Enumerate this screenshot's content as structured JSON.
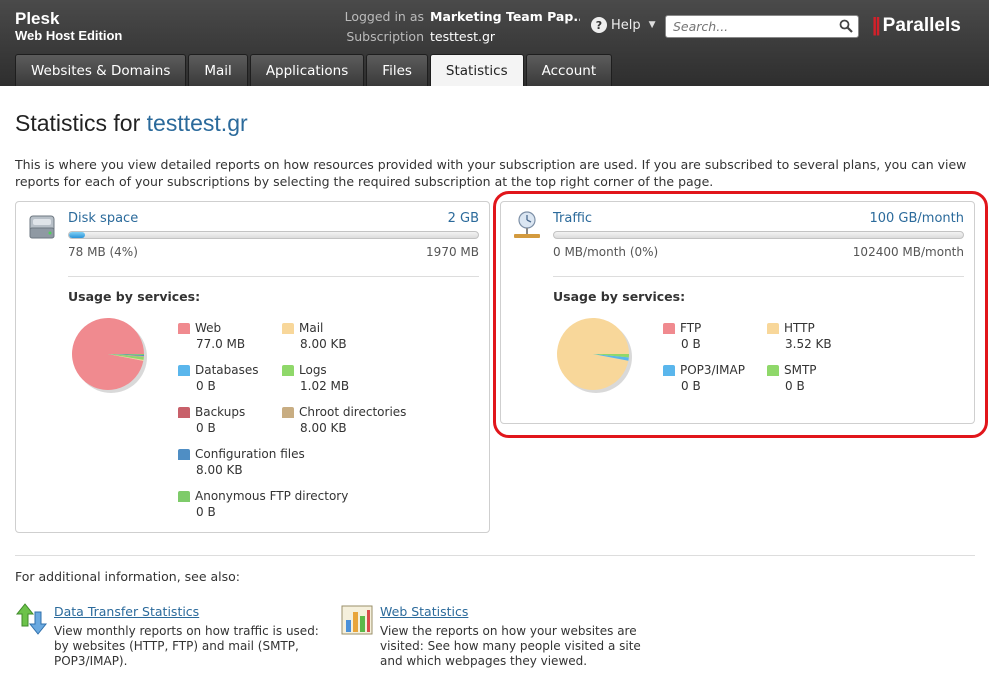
{
  "brand": {
    "name": "Plesk",
    "edition": "Web Host Edition"
  },
  "account": {
    "logged_in_label": "Logged in as",
    "logged_in_value": "Marketing Team Pap...",
    "subscription_label": "Subscription",
    "subscription_value": "testtest.gr"
  },
  "help_label": "Help",
  "search": {
    "placeholder": "Search..."
  },
  "logo_text": "Parallels",
  "tabs": [
    {
      "label": "Websites & Domains"
    },
    {
      "label": "Mail"
    },
    {
      "label": "Applications"
    },
    {
      "label": "Files"
    },
    {
      "label": "Statistics",
      "active": true
    },
    {
      "label": "Account"
    }
  ],
  "page": {
    "title_prefix": "Statistics for",
    "title_domain": "testtest.gr",
    "intro": "This is where you view detailed reports on how resources provided with your subscription are used. If you are subscribed to several plans, you can view reports for each of your subscriptions by selecting the required subscription at the top right corner of the page."
  },
  "disk": {
    "title": "Disk space",
    "limit": "2 GB",
    "used": "78 MB (4%)",
    "total": "1970 MB",
    "usage_fraction": 0.04,
    "usage_label": "Usage by services:",
    "services": [
      {
        "name": "Web",
        "value": "77.0 MB",
        "color": "#f08a8f",
        "amount": 77.0
      },
      {
        "name": "Mail",
        "value": "8.00 KB",
        "color": "#f8d79a",
        "amount": 0.35
      },
      {
        "name": "Databases",
        "value": "0 B",
        "color": "#5ab6ec",
        "amount": 0
      },
      {
        "name": "Logs",
        "value": "1.02 MB",
        "color": "#8fd86a",
        "amount": 1.02
      },
      {
        "name": "Backups",
        "value": "0 B",
        "color": "#c8606a",
        "amount": 0
      },
      {
        "name": "Chroot directories",
        "value": "8.00 KB",
        "color": "#c8ad82",
        "amount": 0.35
      },
      {
        "name": "Configuration files",
        "value": "8.00 KB",
        "color": "#4f8ec4",
        "amount": 0.35
      },
      {
        "name": "Anonymous FTP directory",
        "value": "0 B",
        "color": "#7ecb6a",
        "amount": 0.35
      }
    ]
  },
  "traffic": {
    "title": "Traffic",
    "limit": "100 GB/month",
    "used": "0 MB/month (0%)",
    "total": "102400 MB/month",
    "usage_fraction": 0,
    "usage_label": "Usage by services:",
    "services": [
      {
        "name": "FTP",
        "value": "0 B",
        "color": "#f08a8f",
        "amount": 0
      },
      {
        "name": "HTTP",
        "value": "3.52 KB",
        "color": "#f8d79a",
        "amount": 97
      },
      {
        "name": "POP3/IMAP",
        "value": "0 B",
        "color": "#5ab6ec",
        "amount": 1.5
      },
      {
        "name": "SMTP",
        "value": "0 B",
        "color": "#8fd86a",
        "amount": 1.5
      }
    ]
  },
  "additional": {
    "label": "For additional information, see also:",
    "links": [
      {
        "title": "Data Transfer Statistics",
        "desc": "View monthly reports on how traffic is used: by websites (HTTP, FTP) and mail (SMTP, POP3/IMAP)."
      },
      {
        "title": "Web Statistics",
        "desc": "View the reports on how your websites are visited: See how many people visited a site and which webpages they viewed."
      }
    ]
  }
}
